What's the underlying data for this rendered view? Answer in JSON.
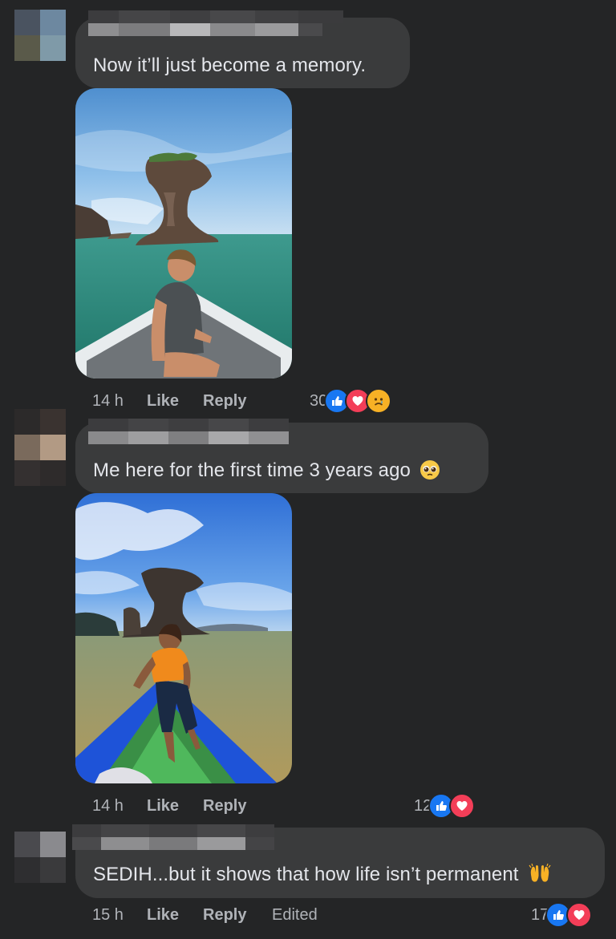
{
  "comments": [
    {
      "text": "Now it’ll just become a memory.",
      "time": "14 h",
      "like_label": "Like",
      "reply_label": "Reply",
      "reaction_count": "30",
      "reactions": [
        "like-icon",
        "love-icon",
        "sad-icon"
      ],
      "photo": "sea-stack-man-on-boat"
    },
    {
      "text": "Me here for the first time 3 years ago",
      "emoji": "pleading-face",
      "time": "14 h",
      "like_label": "Like",
      "reply_label": "Reply",
      "reaction_count": "12",
      "reactions": [
        "like-icon",
        "love-icon"
      ],
      "photo": "sea-stack-woman-on-boat"
    },
    {
      "text": "SEDIH...but it shows that how life isn’t permanent",
      "emoji": "raising-hands",
      "time": "15 h",
      "like_label": "Like",
      "reply_label": "Reply",
      "edited_label": "Edited",
      "reaction_count": "17",
      "reactions": [
        "like-icon",
        "love-icon"
      ]
    }
  ],
  "colors": {
    "background": "#242526",
    "bubble": "#3a3b3c",
    "text": "#e4e6eb",
    "meta": "#b0b3b8",
    "like": "#1877f2",
    "love": "#f33e58",
    "sad": "#f7b125"
  }
}
